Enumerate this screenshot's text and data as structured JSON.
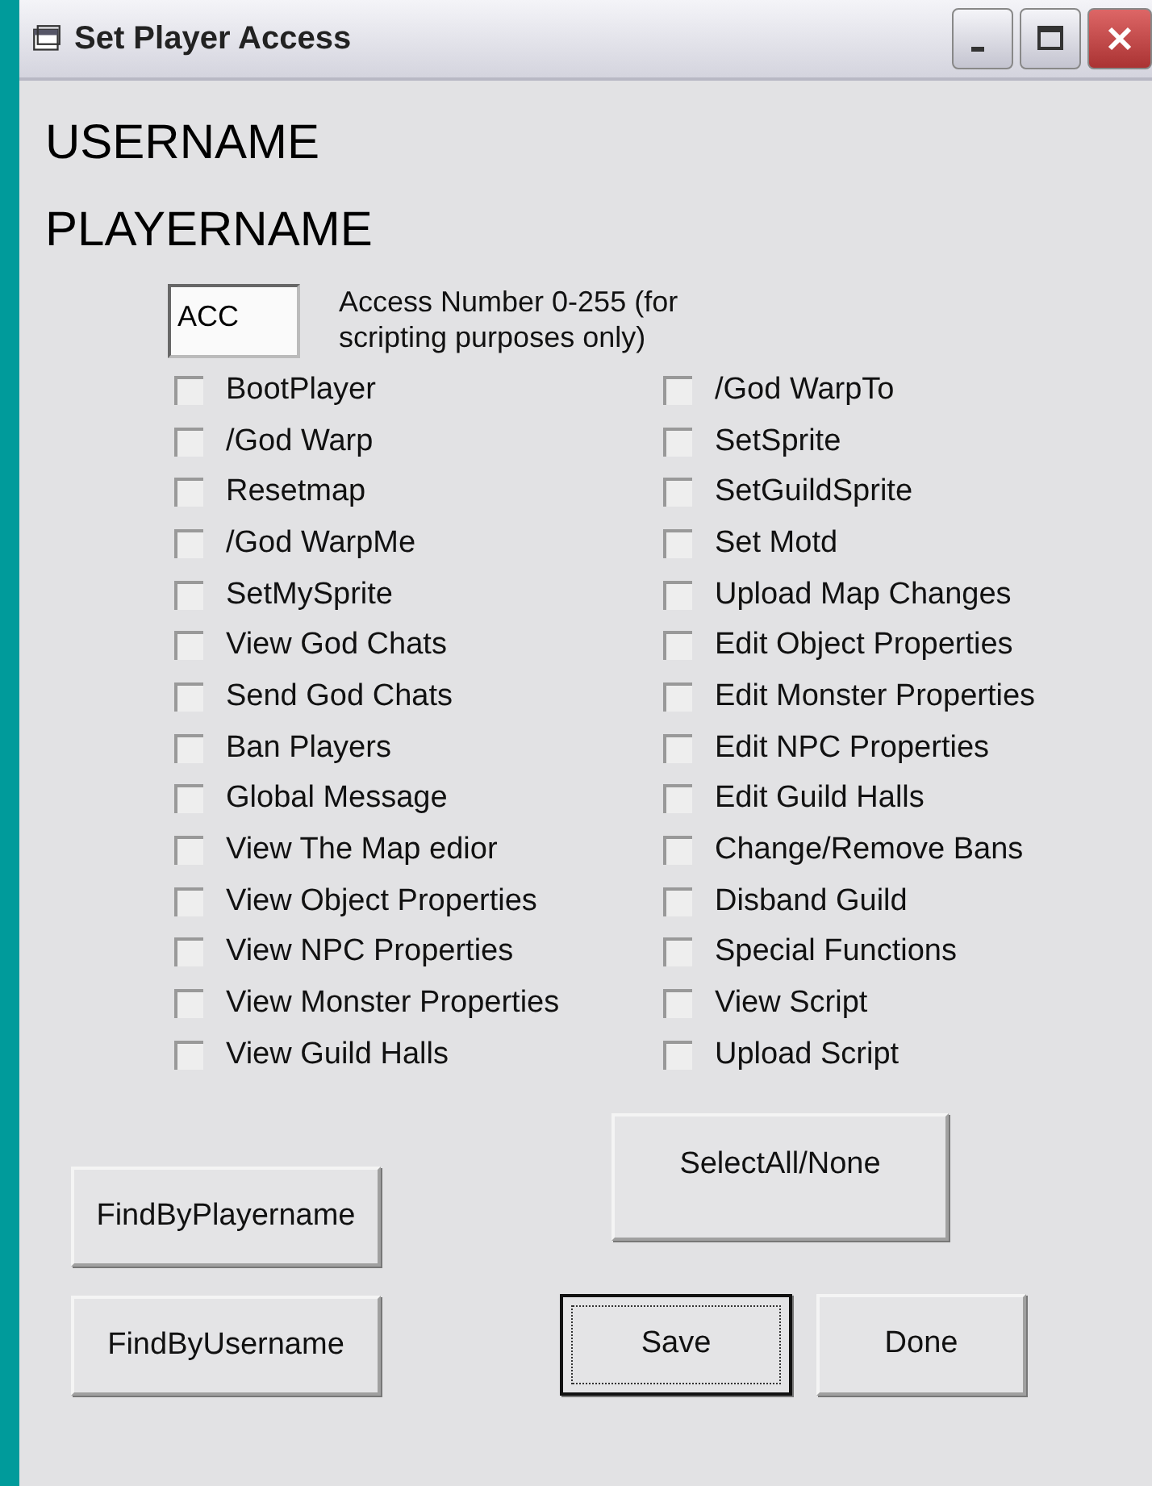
{
  "window": {
    "title": "Set Player Access"
  },
  "username": "USERNAME",
  "playername": "PLAYERNAME",
  "access": {
    "value": "ACC",
    "label": "Access Number 0-255 (for scripting purposes only)"
  },
  "permissions_left": [
    {
      "label": "BootPlayer",
      "checked": false
    },
    {
      "label": "/God Warp",
      "checked": false
    },
    {
      "label": "Resetmap",
      "checked": false
    },
    {
      "label": "/God WarpMe",
      "checked": false
    },
    {
      "label": "SetMySprite",
      "checked": false
    },
    {
      "label": "View God Chats",
      "checked": false
    },
    {
      "label": "Send God Chats",
      "checked": false
    },
    {
      "label": "Ban Players",
      "checked": false
    },
    {
      "label": "Global Message",
      "checked": false
    },
    {
      "label": "View The Map edior",
      "checked": false
    },
    {
      "label": "View Object Properties",
      "checked": false
    },
    {
      "label": "View NPC Properties",
      "checked": false
    },
    {
      "label": "View Monster Properties",
      "checked": false
    },
    {
      "label": "View Guild Halls",
      "checked": false
    }
  ],
  "permissions_right": [
    {
      "label": "/God WarpTo",
      "checked": false
    },
    {
      "label": "SetSprite",
      "checked": false
    },
    {
      "label": "SetGuildSprite",
      "checked": false
    },
    {
      "label": "Set Motd",
      "checked": false
    },
    {
      "label": "Upload Map Changes",
      "checked": false
    },
    {
      "label": "Edit Object Properties",
      "checked": false
    },
    {
      "label": "Edit Monster Properties",
      "checked": false
    },
    {
      "label": "Edit NPC Properties",
      "checked": false
    },
    {
      "label": "Edit Guild Halls",
      "checked": false
    },
    {
      "label": "Change/Remove Bans",
      "checked": false
    },
    {
      "label": "Disband Guild",
      "checked": false
    },
    {
      "label": "Special Functions",
      "checked": false
    },
    {
      "label": "View Script",
      "checked": false
    },
    {
      "label": "Upload Script",
      "checked": false
    }
  ],
  "buttons": {
    "select_all": {
      "label": "SelectAll/None",
      "default": false
    },
    "find_by_playername": {
      "label": "FindByPlayername",
      "default": false
    },
    "find_by_username": {
      "label": "FindByUsername",
      "default": false
    },
    "save": {
      "label": "Save",
      "default": true
    },
    "done": {
      "label": "Done",
      "default": false
    }
  }
}
